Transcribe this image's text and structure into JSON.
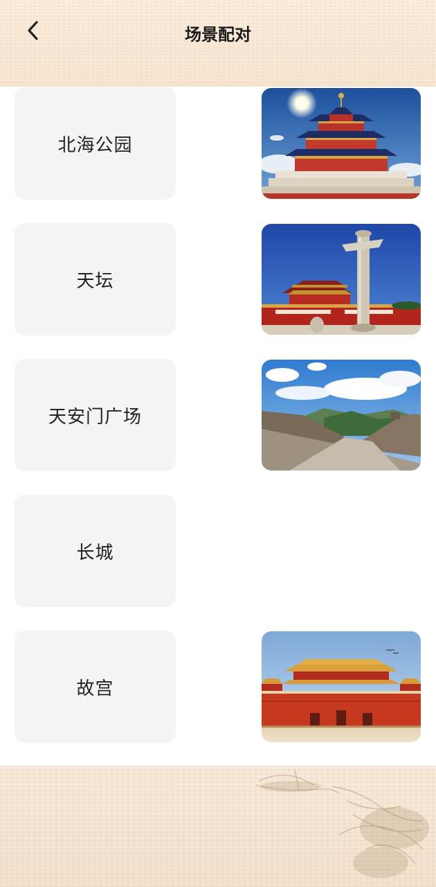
{
  "header": {
    "title": "场景配对",
    "back_icon": "chevron-left-icon"
  },
  "pairs": [
    {
      "label": "北海公园",
      "image": "temple-of-heaven-photo"
    },
    {
      "label": "天坛",
      "image": "tiananmen-huabiao-photo"
    },
    {
      "label": "天安门广场",
      "image": "great-wall-photo"
    },
    {
      "label": "长城",
      "image": null
    },
    {
      "label": "故宫",
      "image": "forbidden-city-meridian-gate-photo"
    }
  ],
  "colors": {
    "header_bg": "#f7e6d2",
    "card_bg": "#f4f4f4",
    "text": "#222222"
  }
}
